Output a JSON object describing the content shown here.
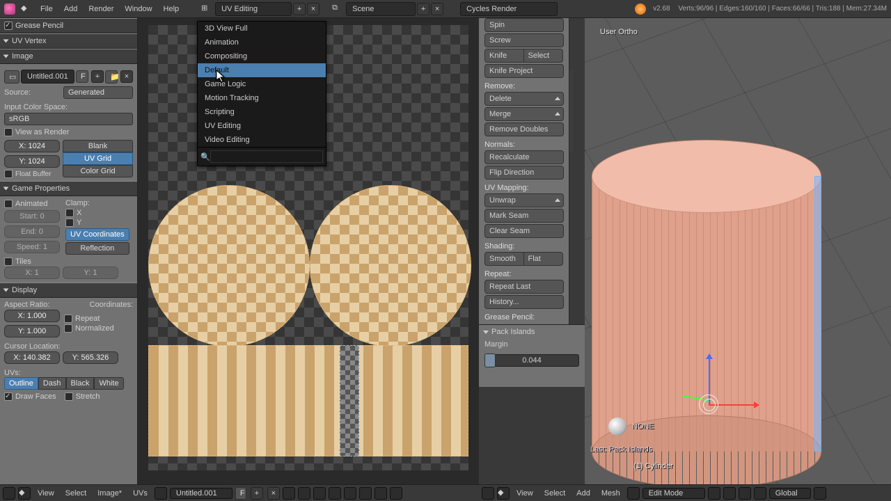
{
  "topbar": {
    "menus": [
      "File",
      "Add",
      "Render",
      "Window",
      "Help"
    ],
    "layout_field": "UV Editing",
    "scene_field": "Scene",
    "engine_field": "Cycles Render",
    "version": "v2.68",
    "stats": "Verts:96/96 | Edges:160/160 | Faces:66/66 | Tris:188 | Mem:27.34M"
  },
  "layout_menu": {
    "items": [
      "3D View Full",
      "Animation",
      "Compositing",
      "Default",
      "Game Logic",
      "Motion Tracking",
      "Scripting",
      "UV Editing",
      "Video Editing"
    ],
    "highlight": "Default"
  },
  "left": {
    "sections": {
      "grease": "Grease Pencil",
      "uvvertex": "UV Vertex",
      "image": "Image",
      "gameprops": "Game Properties",
      "display": "Display"
    },
    "image_field": "Untitled.001",
    "source_lbl": "Source:",
    "source_val": "Generated",
    "colorspace_lbl": "Input Color Space:",
    "colorspace_val": "sRGB",
    "view_as_render": "View as Render",
    "x": "X: 1024",
    "y": "Y: 1024",
    "float_buffer": "Float Buffer",
    "blank": "Blank",
    "uvgrid": "UV Grid",
    "colorgrid": "Color Grid",
    "animated": "Animated",
    "clamp": "Clamp:",
    "start": "Start: 0",
    "end": "End: 0",
    "speed": "Speed: 1",
    "cx": "X",
    "cy": "Y",
    "uvcoord": "UV Coordinates",
    "reflection": "Reflection",
    "tiles": "Tiles",
    "tx": "X: 1",
    "ty": "Y: 1",
    "aspect_lbl": "Aspect Ratio:",
    "aspx": "X: 1.000",
    "aspy": "Y: 1.000",
    "coords_lbl": "Coordinates:",
    "repeat": "Repeat",
    "normalized": "Normalized",
    "cursor_lbl": "Cursor Location:",
    "curx": "X: 140.382",
    "cury": "Y: 565.326",
    "uvs_lbl": "UVs:",
    "outline": "Outline",
    "dash": "Dash",
    "black": "Black",
    "white": "White",
    "drawfaces": "Draw Faces",
    "stretch": "Stretch"
  },
  "meshtools": {
    "items": [
      {
        "t": "b",
        "label": "Spin"
      },
      {
        "t": "b",
        "label": "Screw"
      },
      {
        "t": "half",
        "a": "Knife",
        "b": "Select"
      },
      {
        "t": "b",
        "label": "Knife Project"
      },
      {
        "t": "sec",
        "label": "Remove:"
      },
      {
        "t": "bd",
        "label": "Delete"
      },
      {
        "t": "bd",
        "label": "Merge"
      },
      {
        "t": "b",
        "label": "Remove Doubles"
      },
      {
        "t": "sec",
        "label": "Normals:"
      },
      {
        "t": "b",
        "label": "Recalculate"
      },
      {
        "t": "b",
        "label": "Flip Direction"
      },
      {
        "t": "sec",
        "label": "UV Mapping:"
      },
      {
        "t": "bd",
        "label": "Unwrap"
      },
      {
        "t": "b",
        "label": "Mark Seam"
      },
      {
        "t": "b",
        "label": "Clear Seam"
      },
      {
        "t": "sec",
        "label": "Shading:"
      },
      {
        "t": "half",
        "a": "Smooth",
        "b": "Flat"
      },
      {
        "t": "sec",
        "label": "Repeat:"
      },
      {
        "t": "b",
        "label": "Repeat Last"
      },
      {
        "t": "b",
        "label": "History..."
      },
      {
        "t": "sec",
        "label": "Grease Pencil:"
      }
    ],
    "lastop_title": "Pack Islands",
    "margin_lbl": "Margin",
    "margin_val": "0.044"
  },
  "view3d": {
    "ortho": "User Ortho",
    "material": "NONE",
    "lastop": "Last: Pack Islands",
    "object": "(1) Cylinder"
  },
  "uvheader": {
    "menus": [
      "View",
      "Select",
      "Image*",
      "UVs"
    ],
    "image_field": "Untitled.001"
  },
  "v3header": {
    "menus": [
      "View",
      "Select",
      "Add",
      "Mesh"
    ],
    "mode": "Edit Mode",
    "orientation": "Global"
  }
}
